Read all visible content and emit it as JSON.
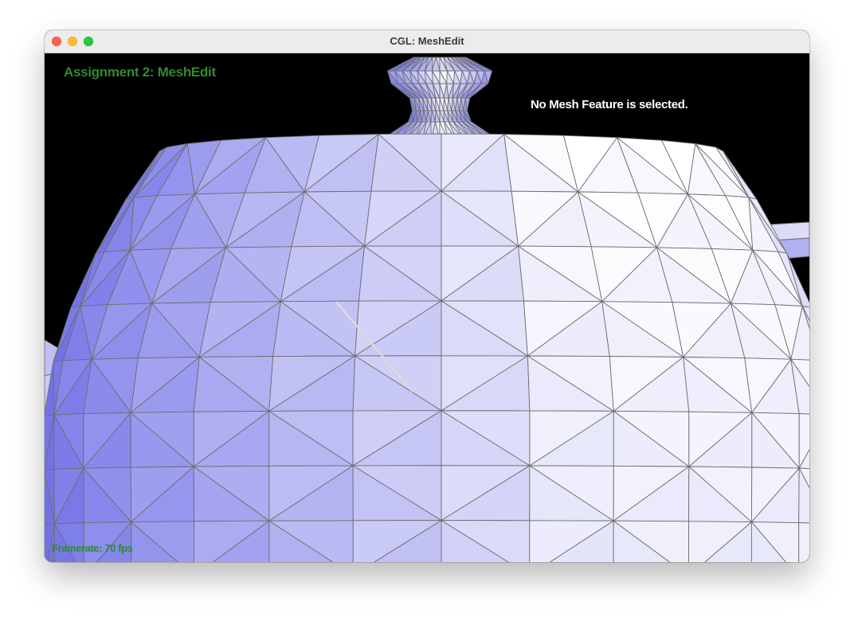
{
  "window": {
    "title": "CGL: MeshEdit"
  },
  "overlay": {
    "assignment_title": "Assignment 2: MeshEdit",
    "selection_status": "No Mesh Feature is selected.",
    "framerate": "Framerate: 70 fps"
  },
  "colors": {
    "background": "#000000",
    "overlay_text": "#2f8a2f",
    "mesh_light": "#ffffff",
    "mesh_dark": "#7272e8",
    "wire": "#6e6e6e"
  }
}
